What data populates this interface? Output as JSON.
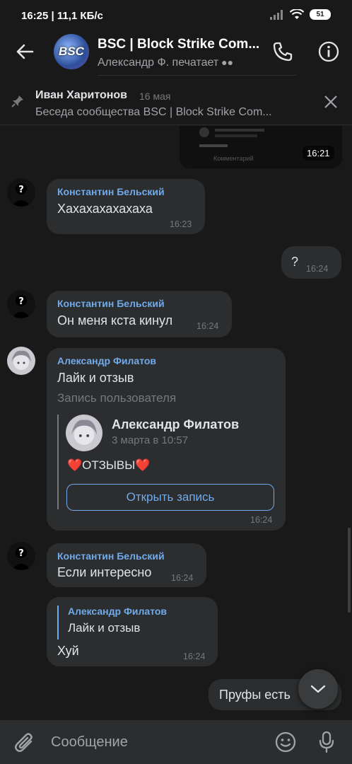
{
  "status": {
    "time": "16:25 | 11,1 КБ/с",
    "battery": "51"
  },
  "header": {
    "avatar_text": "BSC",
    "title": "BSC | Block Strike Com...",
    "subtitle": "Александр Ф. печатает"
  },
  "pinned": {
    "author": "Иван Харитонов",
    "date": "16 мая",
    "text": "Беседа сообщества BSC | Block Strike Com..."
  },
  "preview": {
    "time": "16:21",
    "comment_label": "Комментарий"
  },
  "messages": [
    {
      "author": "Константин Бельский",
      "text": "Хахахахахахаха",
      "time": "16:23"
    },
    {
      "text": "?",
      "time": "16:24"
    },
    {
      "author": "Константин Бельский",
      "text": "Он меня кста кинул",
      "time": "16:24"
    },
    {
      "author": "Александр Филатов",
      "text": "Лайк и отзыв",
      "repost_label": "Запись пользователя",
      "post_author": "Александр Филатов",
      "post_date": "3 марта в 10:57",
      "post_text": "❤️ОТЗЫВЫ❤️",
      "button": "Открыть запись",
      "time": "16:24"
    },
    {
      "author": "Константин Бельский",
      "text": "Если интересно",
      "time": "16:24"
    },
    {
      "reply_author": "Александр Филатов",
      "reply_text": "Лайк и отзыв",
      "text": "Хуй",
      "time": "16:24"
    },
    {
      "text": "Пруфы есть"
    }
  ],
  "composer": {
    "placeholder": "Сообщение"
  },
  "colors": {
    "bg": "#19191a",
    "bubble": "#2c2d2e",
    "accent": "#71aaeb"
  }
}
